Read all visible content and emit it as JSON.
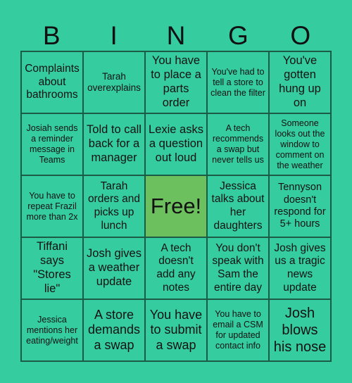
{
  "title_letters": [
    "B",
    "I",
    "N",
    "G",
    "O"
  ],
  "free_label": "Free!",
  "colors": {
    "background": "#35cd9f",
    "free_cell": "#6cc05d",
    "grid_line": "#1b5a45"
  },
  "cells": [
    [
      "Complaints about bathrooms",
      "Tarah overexplains",
      "You have to place a parts order",
      "You've had to tell a store to clean the filter",
      "You've gotten hung up on"
    ],
    [
      "Josiah sends a reminder message in Teams",
      "Told to call back for a manager",
      "Lexie asks a question out loud",
      "A tech recommends a swap but never tells us",
      "Someone looks out the window to comment on the weather"
    ],
    [
      "You have to repeat Frazil more than 2x",
      "Tarah orders and picks up lunch",
      "Free!",
      "Jessica talks about her daughters",
      "Tennyson doesn't respond for 5+ hours"
    ],
    [
      "Tiffani says \"Stores lie\"",
      "Josh gives a weather update",
      "A tech doesn't add any notes",
      "You don't speak with Sam the entire day",
      "Josh gives us a tragic news update"
    ],
    [
      "Jessica mentions her eating/weight",
      "A store demands a swap",
      "You have to submit a swap",
      "You have to email a CSM for updated contact info",
      "Josh blows his nose"
    ]
  ]
}
